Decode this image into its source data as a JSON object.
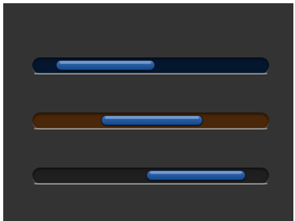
{
  "scrollbars": [
    {
      "id": "blue",
      "track_color": "#05172f",
      "thumb_color": "#164a8c",
      "thumb_start": 0.1,
      "thumb_end": 0.52
    },
    {
      "id": "orange",
      "track_color": "#4a2708",
      "thumb_color": "#164a8c",
      "thumb_start": 0.29,
      "thumb_end": 0.72
    },
    {
      "id": "dark",
      "track_color": "#1f1f1f",
      "thumb_color": "#164a8c",
      "thumb_start": 0.48,
      "thumb_end": 0.9
    }
  ]
}
